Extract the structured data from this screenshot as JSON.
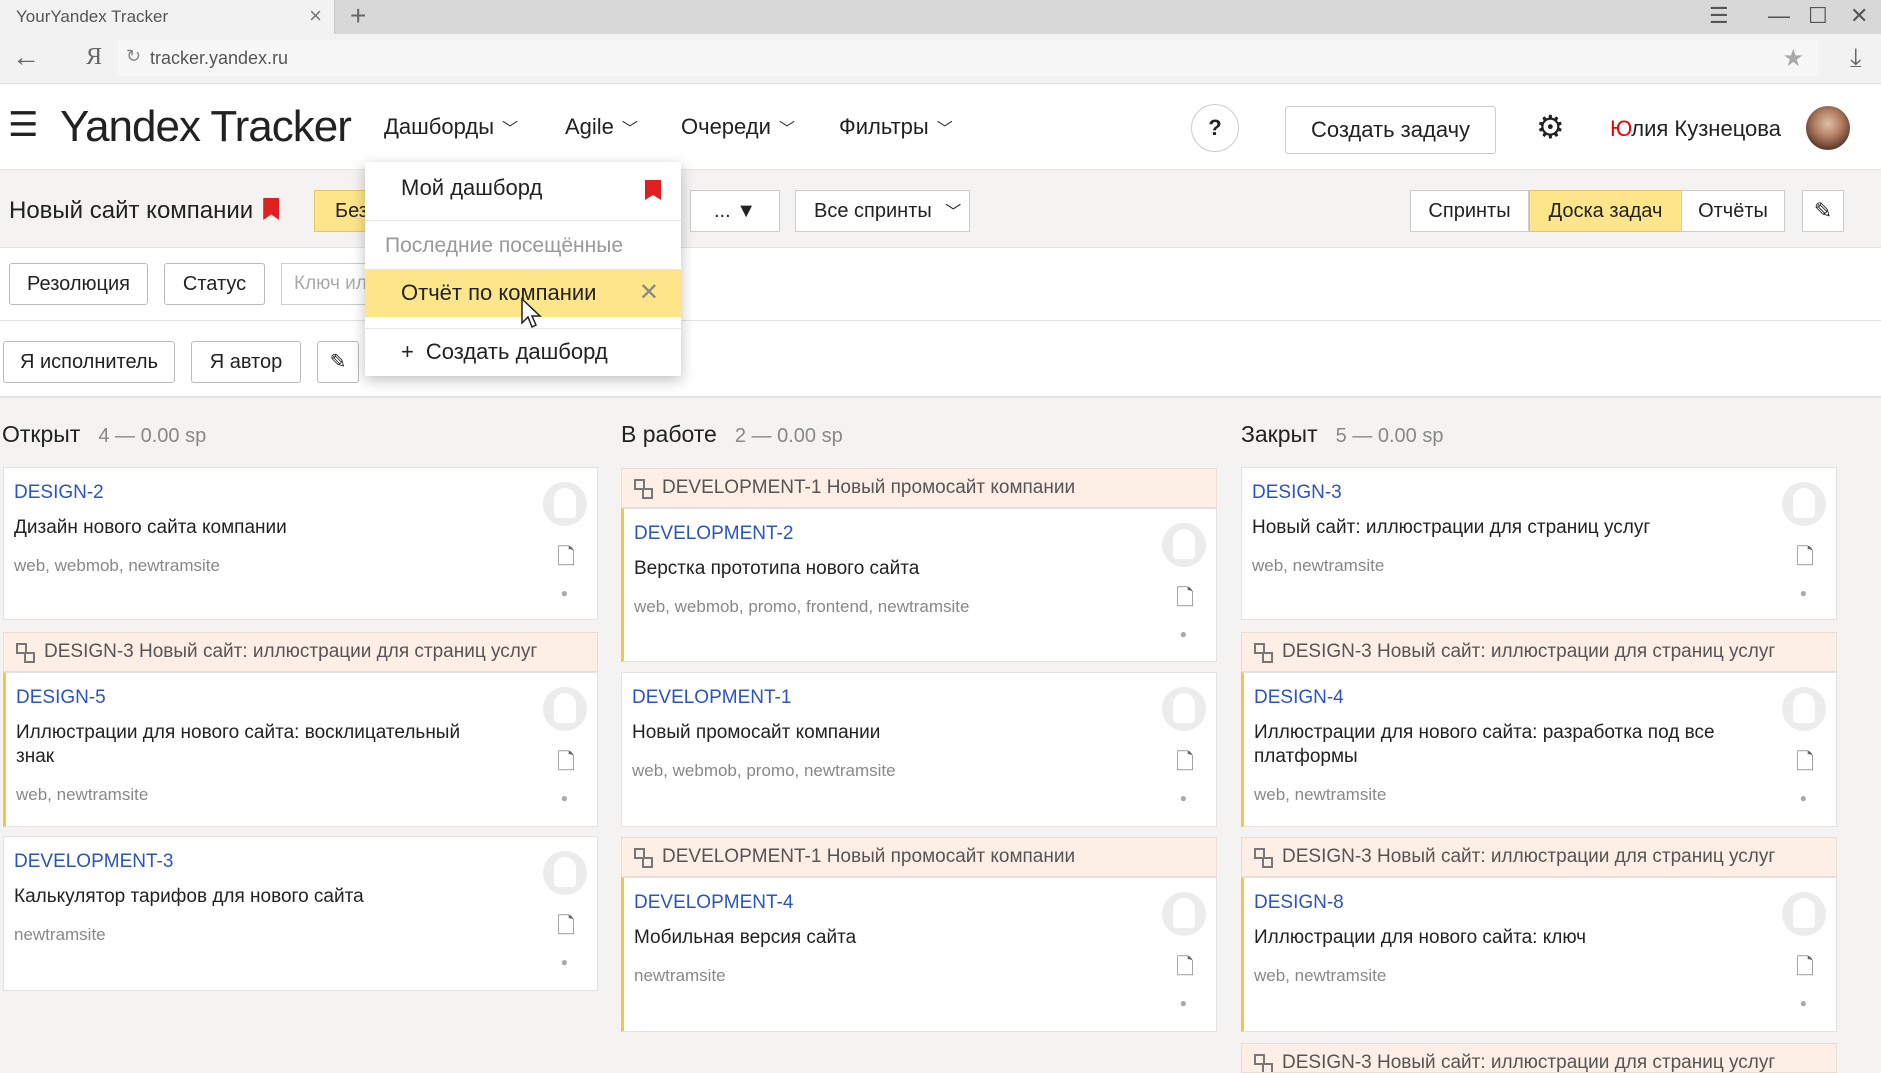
{
  "browser": {
    "tab_title": "YourYandex Tracker",
    "url": "tracker.yandex.ru"
  },
  "header": {
    "logo_part1": "Yandex",
    "logo_part2": "Tracker",
    "nav": [
      {
        "label": "Дашборды"
      },
      {
        "label": "Agile"
      },
      {
        "label": "Очереди"
      },
      {
        "label": "Фильтры"
      }
    ],
    "help": "?",
    "create_task": "Создать задачу",
    "user_first": "Ю",
    "user_rest": "лия Кузнецова"
  },
  "subheader": {
    "project_title": "Новый сайт компании",
    "hidden_btn": "Без",
    "dots_btn": "... ▼",
    "sprints_select": "Все спринты",
    "views": [
      "Спринты",
      "Доска задач",
      "Отчёты"
    ]
  },
  "filters": {
    "resolution": "Резолюция",
    "status": "Статус",
    "key_placeholder": "Ключ или",
    "assignee_me": "Я исполнитель",
    "author_me": "Я автор"
  },
  "dropdown": {
    "my_dashboard": "Мой дашборд",
    "recent_section": "Последние посещённые",
    "recent_item": "Отчёт по компании",
    "create": "Создать дашборд"
  },
  "columns": [
    {
      "name": "Открыт",
      "count": "4 — 0.00 sp",
      "cards": [
        {
          "key": "DESIGN-2",
          "title": "Дизайн нового сайта компании",
          "tags": "web, webmob, newtramsite"
        },
        {
          "parent": "DESIGN-3 Новый сайт: иллюстрации для страниц услуг",
          "key": "DESIGN-5",
          "title": "Иллюстрации для нового сайта: восклицательный знак",
          "tags": "web, newtramsite"
        },
        {
          "key": "DEVELOPMENT-3",
          "title": "Калькулятор тарифов для нового сайта",
          "tags": "newtramsite"
        }
      ]
    },
    {
      "name": "В работе",
      "count": "2 — 0.00 sp",
      "cards": [
        {
          "parent": "DEVELOPMENT-1 Новый промосайт компании",
          "key": "DEVELOPMENT-2",
          "title": "Верстка прототипа нового сайта",
          "tags": "web, webmob, promo, frontend, newtramsite"
        },
        {
          "key": "DEVELOPMENT-1",
          "title": "Новый промосайт компании",
          "tags": "web, webmob, promo, newtramsite"
        },
        {
          "parent": "DEVELOPMENT-1 Новый промосайт компании",
          "key": "DEVELOPMENT-4",
          "title": "Мобильная версия сайта",
          "tags": "newtramsite"
        }
      ]
    },
    {
      "name": "Закрыт",
      "count": "5 — 0.00 sp",
      "cards": [
        {
          "key": "DESIGN-3",
          "title": "Новый сайт: иллюстрации для страниц услуг",
          "tags": "web, newtramsite"
        },
        {
          "parent": "DESIGN-3 Новый сайт: иллюстрации для страниц услуг",
          "key": "DESIGN-4",
          "title": "Иллюстрации для нового сайта: разработка под все платформы",
          "tags": "web, newtramsite"
        },
        {
          "parent": "DESIGN-3 Новый сайт: иллюстрации для страниц услуг",
          "key": "DESIGN-8",
          "title": "Иллюстрации для нового сайта: ключ",
          "tags": "web, newtramsite"
        },
        {
          "parent": "DESIGN-3 Новый сайт: иллюстрации для страниц услуг"
        }
      ]
    }
  ],
  "colors": {
    "accent_yellow": "#fde58a",
    "link_blue": "#2a54c4",
    "bookmark_red": "#e02020",
    "parent_bg": "#fdeee6"
  },
  "icons": [
    "menu-icon",
    "help-icon",
    "gear-icon",
    "bookmark-icon",
    "close-icon",
    "plus-icon",
    "edit-icon",
    "document-icon",
    "parent-link-icon",
    "chevron-down-icon"
  ]
}
